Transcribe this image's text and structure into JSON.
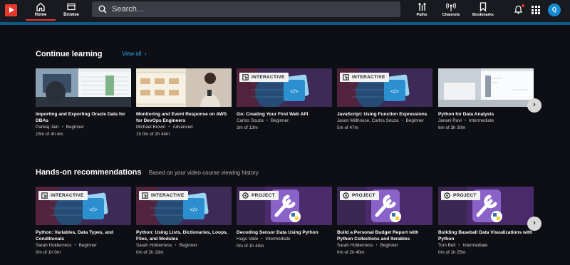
{
  "nav": {
    "home_label": "Home",
    "browse_label": "Browse",
    "search_placeholder": "Search...",
    "paths_label": "Paths",
    "channels_label": "Channels",
    "bookmarks_label": "Bookmarks",
    "avatar_initial": "Q"
  },
  "continue_learning": {
    "title": "Continue learning",
    "view_all": "View all",
    "cards": [
      {
        "title": "Importing and Exporting Oracle Data for DBAs",
        "author": "Pankaj Jain",
        "level": "Beginner",
        "progress": "15m of 4h 4m",
        "thumb": "office-photo"
      },
      {
        "title": "Monitoring and Event Response on AWS for DevOps Engineers",
        "author": "Michael Brown",
        "level": "Advanced",
        "progress": "1h 0m of 2h 44m",
        "thumb": "woman-phone"
      },
      {
        "title": "Go: Creating Your First Web API",
        "author": "Carlos Souza",
        "level": "Beginner",
        "progress": "3m of 13m",
        "thumb": "interactive-code",
        "badge": "INTERACTIVE"
      },
      {
        "title": "JavaScript: Using Function Expressions",
        "author": "Jason Millhouse, Carlos Souza",
        "level": "Beginner",
        "progress": "5m of 47m",
        "thumb": "interactive-code",
        "badge": "INTERACTIVE"
      },
      {
        "title": "Python for Data Analysts",
        "author": "Janani Ravi",
        "level": "Intermediate",
        "progress": "6m of 3h 30m",
        "thumb": "laptop-desk"
      }
    ]
  },
  "hands_on": {
    "title": "Hands-on recommendations",
    "subtitle": "Based on your video course viewing history",
    "cards": [
      {
        "title": "Python: Variables, Data Types, and Conditionals",
        "author": "Sarah Holderness",
        "level": "Beginner",
        "progress": "0m of 1h 0m",
        "thumb": "interactive-code",
        "badge": "INTERACTIVE"
      },
      {
        "title": "Python: Using Lists, Dictionaries, Loops, Files, and Modules",
        "author": "Sarah Holderness",
        "level": "Beginner",
        "progress": "0m of 2h 18m",
        "thumb": "interactive-code",
        "badge": "INTERACTIVE"
      },
      {
        "title": "Decoding Sensor Data Using Python",
        "author": "Hugo Valle",
        "level": "Intermediate",
        "progress": "0m of 1h 40m",
        "thumb": "project-wrench",
        "badge": "PROJECT"
      },
      {
        "title": "Build a Personal Budget Report with Python Collections and Iterables",
        "author": "Sarah Holderness",
        "level": "Beginner",
        "progress": "0m of 2h 40m",
        "thumb": "project-wrench",
        "badge": "PROJECT"
      },
      {
        "title": "Building Baseball Data Visualizations with Python",
        "author": "Tom Bell",
        "level": "Intermediate",
        "progress": "0m of 1h 25m",
        "thumb": "project-wrench",
        "badge": "PROJECT"
      }
    ]
  },
  "colors": {
    "accent": "#e8372b",
    "link": "#2aa9f0",
    "avatar": "#168bd1"
  }
}
